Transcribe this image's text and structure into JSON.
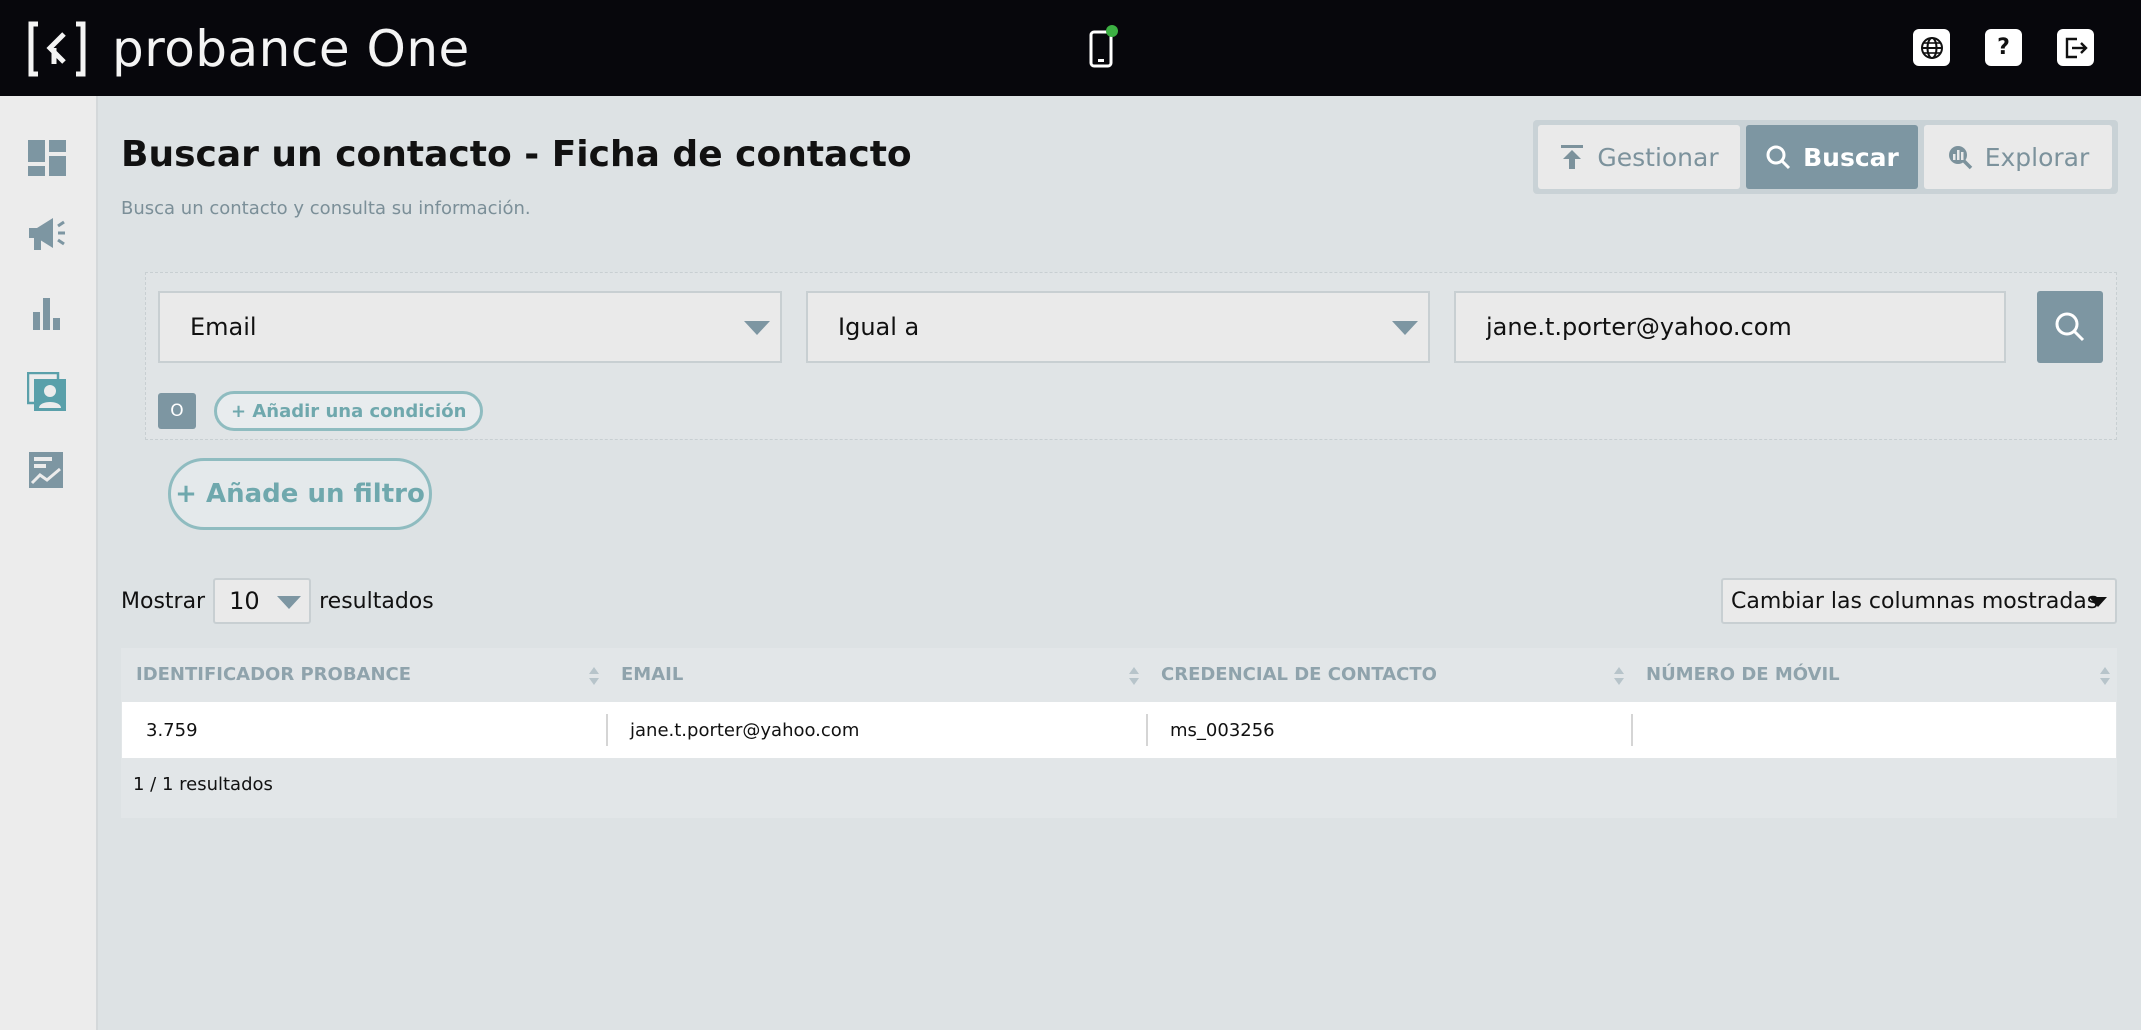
{
  "app": {
    "title": "probance One"
  },
  "header": {
    "icons": [
      "mobile-phone-icon",
      "globe-icon",
      "help-icon",
      "logout-icon"
    ],
    "help_label": "?",
    "notification_color": "#3cb043"
  },
  "sidebar": {
    "items": [
      {
        "name": "dashboard-icon"
      },
      {
        "name": "megaphone-icon"
      },
      {
        "name": "bar-chart-icon"
      },
      {
        "name": "contacts-icon"
      },
      {
        "name": "report-icon"
      }
    ]
  },
  "page": {
    "title": "Buscar un contacto - Ficha de contacto",
    "subtitle": "Busca un contacto y consulta su información."
  },
  "modes": {
    "manage_label": "Gestionar",
    "search_label": "Buscar",
    "explore_label": "Explorar",
    "active": "Buscar"
  },
  "filter": {
    "field_value": "Email",
    "operator_value": "Igual a",
    "input_value": "jane.t.porter@yahoo.com",
    "or_label": "O",
    "add_condition_label": "+  Añadir una condición",
    "add_filter_label": "+  Añade un filtro"
  },
  "listing": {
    "show_label": "Mostrar",
    "page_size": "10",
    "results_label": "resultados",
    "columns_toggle_label": "Cambiar las columnas mostradas"
  },
  "table": {
    "headers": [
      "IDENTIFICADOR PROBANCE",
      "EMAIL",
      "CREDENCIAL DE CONTACTO",
      "NÚMERO DE MÓVIL"
    ],
    "rows": [
      [
        "3.759",
        "jane.t.porter@yahoo.com",
        "ms_003256",
        ""
      ]
    ],
    "count_label": "1 / 1 resultados"
  },
  "colors": {
    "accent": "#7d96a2",
    "outline_accent": "#8fbcc0",
    "topbar": "#07070c"
  }
}
